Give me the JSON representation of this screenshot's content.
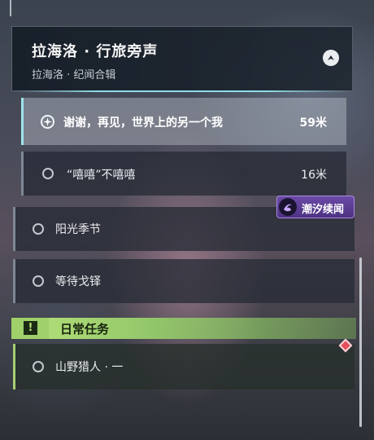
{
  "header": {
    "title": "拉海洛 · 行旅旁声",
    "subtitle": "拉海洛 · 纪闻合辑",
    "collapse_icon": "chevron-up-icon"
  },
  "quests": [
    {
      "label": "谢谢，再见，世界上的另一个我",
      "distance": "59米",
      "state": "tracked"
    },
    {
      "label": "“嘻嘻”不嘻嘻",
      "distance": "16米",
      "state": "available"
    },
    {
      "label": "阳光季节",
      "distance": "",
      "state": "available"
    },
    {
      "label": "等待戈铎",
      "distance": "",
      "state": "available"
    }
  ],
  "badge": {
    "label": "潮汐续闻",
    "color": "#6b4aa8"
  },
  "daily": {
    "title": "日常任务",
    "icon": "exclamation-icon",
    "color": "#b8e37a",
    "items": [
      {
        "label": "山野猎人 · 一",
        "distance": ""
      }
    ]
  },
  "marker": {
    "icon": "map-pin-diamond-icon",
    "color": "#e44f5a"
  }
}
